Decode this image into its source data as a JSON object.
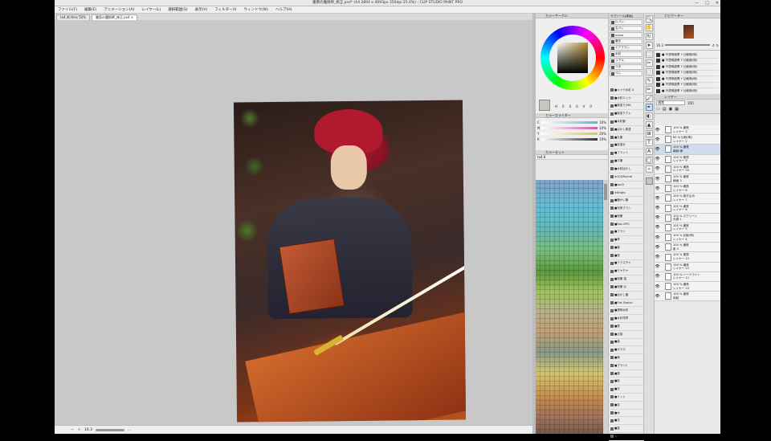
{
  "window": {
    "title": "書斎の魔術師_修正.psd* (A4 2894 x 4093px 350dpi 25.0%)  - CLIP STUDIO PAINT PRO",
    "controls": [
      "—",
      "□",
      "✕"
    ]
  },
  "menu": [
    "ファイル(F)",
    "編集(E)",
    "アニメーション(A)",
    "レイヤー(L)",
    "選択範囲(S)",
    "表示(V)",
    "フィルター(I)",
    "ウィンドウ(W)",
    "ヘルプ(H)"
  ],
  "tabs": [
    {
      "label": "ta4.dt.thes 50%",
      "active": false
    },
    {
      "label": "書斎の魔術師_修正.psd ×",
      "active": true
    }
  ],
  "status": {
    "zoom": "16.3",
    "tail": "..."
  },
  "color_panel": {
    "wheel_tab": "カラーサークル",
    "hsv": [
      "H",
      "0",
      "S",
      "0",
      "V",
      "0"
    ],
    "slider_tab": "カラースライダー",
    "sliders": [
      {
        "label": "C",
        "value": "10%",
        "color": "#5ab5d8"
      },
      {
        "label": "M",
        "value": "10%",
        "color": "#d25a9a"
      },
      {
        "label": "Y",
        "value": "20%",
        "color": "#d8c84a"
      },
      {
        "label": "K",
        "value": "19%",
        "color": "#555555"
      }
    ],
    "set_tab": "カラーセット",
    "set_name": "ta4.8"
  },
  "sub_tool": {
    "header": "サブツール[線画]",
    "buttons": [
      "G-ペン",
      "丸ペン",
      "mono",
      "筆圧",
      "エアブラシ",
      "水彩",
      "リアル",
      "ベタ",
      "ペン"
    ],
    "materials": [
      "■キャラ水彩 4",
      "■水彩エッジ",
      "■厚塗り(MK",
      "■厚塗りクレ",
      "■水彩筆",
      "■ぼかし厚塗",
      "■丸筆",
      "■色混ぜ",
      "■フラット",
      "■平筆",
      "■水彩ぼかし",
      "★100/Raindr",
      "■sbd3",
      "★Bright",
      "■暖かい筆",
      "■布鉄ブラシ",
      "■鉛筆",
      "■Doc.GPO",
      "■ブラシ",
      "■草",
      "■葉",
      "■枝",
      "■テクスチャ",
      "■モヤモヤ",
      "■鉛筆 濃",
      "■鉛筆 淡",
      "■ぼかし筆",
      "■Flat Sketch",
      "■透明水彩",
      "■水彩境界",
      "■霧",
      "■点描",
      "■森",
      "■ガラス",
      "■線",
      "■ブラシ2",
      "■雲",
      "■影",
      "■光",
      "■ドット",
      "■岩",
      "■木",
      "■花",
      "■星",
      "■水"
    ]
  },
  "tools": [
    "🔍",
    "✋",
    "↻",
    "➤",
    "⬚",
    "✂",
    "◌",
    "✎",
    "✏",
    "🖌",
    "✒",
    "◐",
    "▲",
    "⊞",
    "T",
    "A",
    "◯",
    "⌁"
  ],
  "navigator": {
    "tab": "ナビゲーター",
    "zoom": "16.3"
  },
  "palette_rows": [
    "■ 不透明度黒  Y 比較暗(明)",
    "■ 不透明度黒  Y 比較暗(明)",
    "■ 不透明度黒  Y 比較暗(明)",
    "■ 不透明度黒  Y 比較暗(明)",
    "■ 不透明度黒  Y 比較暗(明)",
    "■ 不透明度黒  Y 比較暗(明)",
    "■ 不透明度黒  Y 比較暗(明)"
  ],
  "layer_panel": {
    "tab": "レイヤー",
    "blend": "通常",
    "opacity": "100",
    "layers": [
      {
        "top": "100 % 通常",
        "name": "レイヤー 3",
        "eye": "👁"
      },
      {
        "top": "60 % 比較(明)",
        "name": "レイヤー 2",
        "eye": "👁"
      },
      {
        "top": "100 % 通常",
        "name": "線画 線",
        "eye": "👁"
      },
      {
        "top": "100 % 乗算",
        "name": "レイヤー 9",
        "eye": "👁"
      },
      {
        "top": "100 % 通常",
        "name": "レイヤー 24",
        "eye": "👁"
      },
      {
        "top": "100 % 通常",
        "name": "線画 3",
        "eye": "👁"
      },
      {
        "top": "100 % 通常",
        "name": "レイヤー 8",
        "eye": "👁"
      },
      {
        "top": "100 % 焼き込み",
        "name": "レイヤー 7",
        "eye": "👁"
      },
      {
        "top": "100 % 通常",
        "name": "レイヤー 6",
        "eye": "👁"
      },
      {
        "top": "100 % スクリーン",
        "name": "光源 1",
        "eye": "👁"
      },
      {
        "top": "100 % 通常",
        "name": "レイヤー 5",
        "eye": "👁"
      },
      {
        "top": "100 % 比較(明)",
        "name": "レイヤー 4",
        "eye": "👁"
      },
      {
        "top": "100 % 通常",
        "name": "影 2",
        "eye": "👁"
      },
      {
        "top": "100 % 乗算",
        "name": "レイヤー 13",
        "eye": "👁"
      },
      {
        "top": "100 % 通常",
        "name": "レイヤー 12",
        "eye": "👁"
      },
      {
        "top": "100 % ハードライト",
        "name": "レイヤー 11",
        "eye": "👁"
      },
      {
        "top": "100 % 通常",
        "name": "レイヤー 10",
        "eye": "👁"
      },
      {
        "top": "100 % 通常",
        "name": "用紙",
        "eye": "👁"
      }
    ]
  }
}
